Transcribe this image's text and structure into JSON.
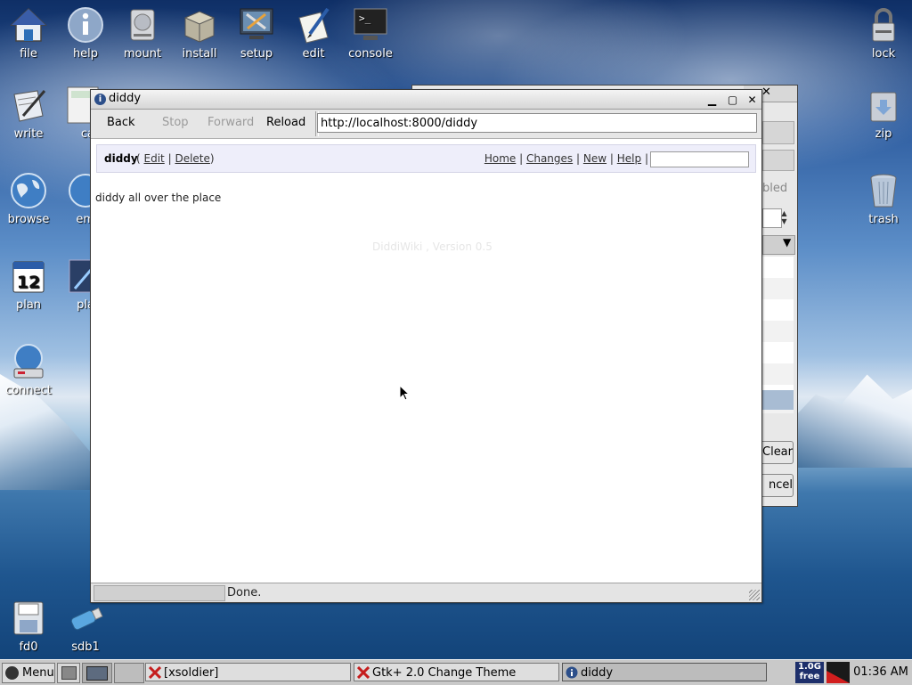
{
  "desktop": {
    "icons_left": [
      {
        "label": "file",
        "icon": "home-icon"
      },
      {
        "label": "help",
        "icon": "info-icon"
      },
      {
        "label": "mount",
        "icon": "drive-icon"
      },
      {
        "label": "install",
        "icon": "package-icon"
      },
      {
        "label": "setup",
        "icon": "setup-icon"
      },
      {
        "label": "edit",
        "icon": "edit-icon"
      },
      {
        "label": "console",
        "icon": "console-icon"
      },
      {
        "label": "write",
        "icon": "write-icon"
      },
      {
        "label": "ca",
        "icon": "calculator-icon"
      },
      {
        "label": "browse",
        "icon": "globe-icon"
      },
      {
        "label": "em",
        "icon": "email-icon"
      },
      {
        "label": "plan",
        "icon": "calendar-icon"
      },
      {
        "label": "pla",
        "icon": "media-icon"
      },
      {
        "label": "connect",
        "icon": "connect-icon"
      },
      {
        "label": "fd0",
        "icon": "floppy-icon"
      },
      {
        "label": "sdb1",
        "icon": "usb-icon"
      }
    ],
    "icons_right": [
      {
        "label": "lock",
        "icon": "lock-icon"
      },
      {
        "label": "zip",
        "icon": "zip-icon"
      },
      {
        "label": "trash",
        "icon": "trash-icon"
      }
    ],
    "calendar_number": "12"
  },
  "back_window": {
    "partial_labels": [
      "bled",
      "Clear",
      "ncel"
    ]
  },
  "browser": {
    "title": "diddy",
    "toolbar": {
      "back": "Back",
      "stop": "Stop",
      "forward": "Forward",
      "reload": "Reload",
      "url": "http://localhost:8000/diddy"
    },
    "wiki": {
      "page_name": "diddy",
      "open_paren": "(",
      "edit": "Edit",
      "sep": "|",
      "delete": "Delete",
      "close_paren": ")",
      "nav": [
        "Home",
        "Changes",
        "New",
        "Help"
      ],
      "body": "diddy all over the place",
      "footer": "DiddiWiki , Version 0.5"
    },
    "status": "Done."
  },
  "taskbar": {
    "menu": "Menu",
    "tasks": [
      {
        "label": "[xsoldier]",
        "active": false
      },
      {
        "label": "Gtk+ 2.0 Change Theme",
        "active": false
      },
      {
        "label": "diddy",
        "active": true
      }
    ],
    "free_line1": "1.0G",
    "free_line2": "free",
    "clock": "01:36 AM"
  }
}
